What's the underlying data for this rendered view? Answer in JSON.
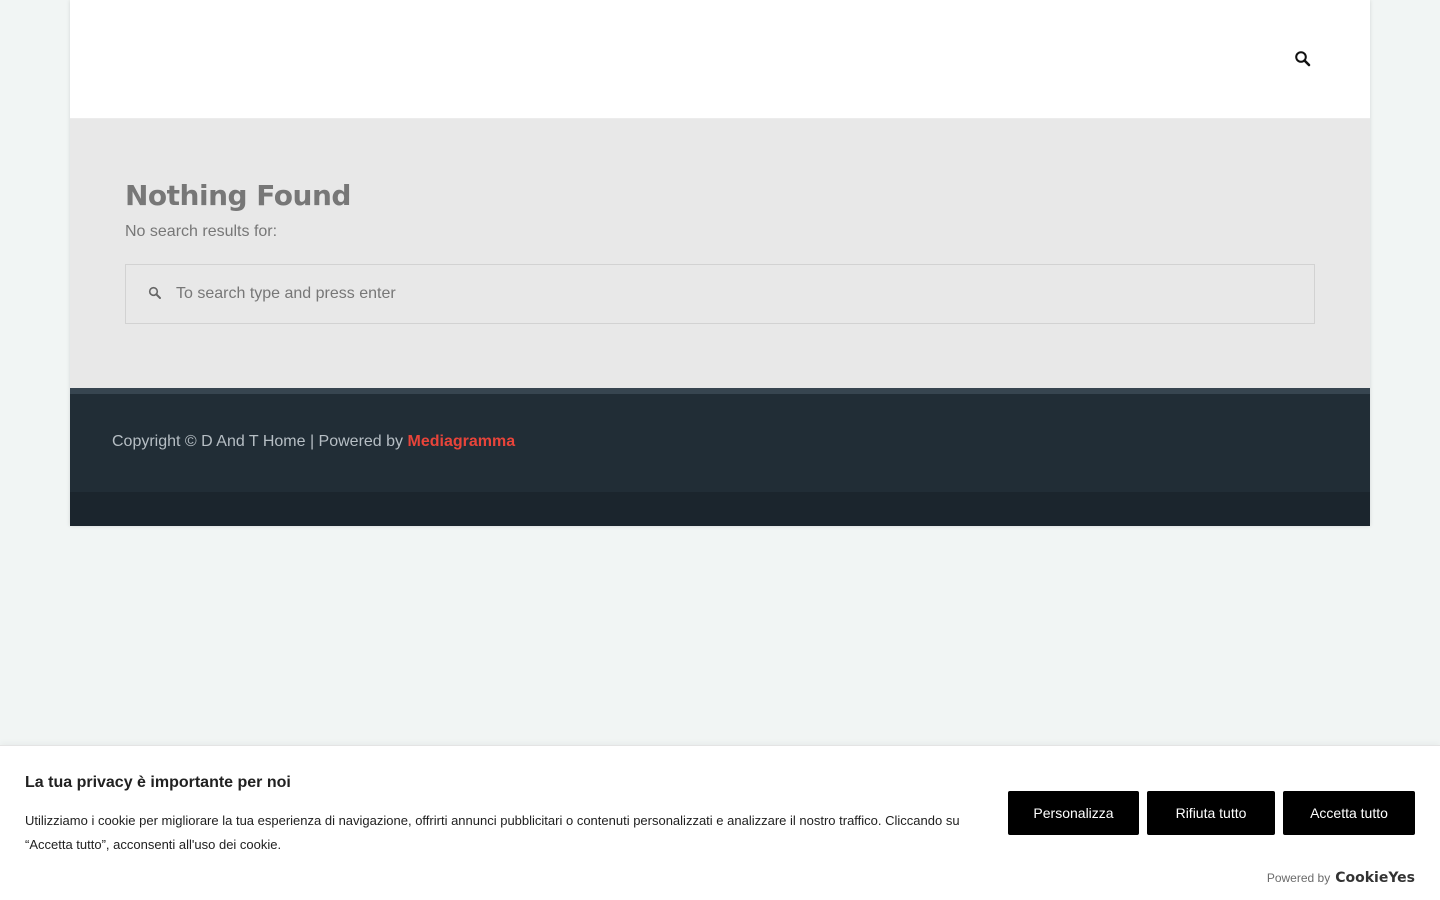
{
  "header": {
    "search_icon": "search-icon"
  },
  "main": {
    "title": "Nothing Found",
    "subtitle": "No search results for:",
    "search": {
      "placeholder": "To search type and press enter",
      "value": "",
      "icon": "search-icon"
    }
  },
  "footer": {
    "copyright": "Copyright © D And T Home | Powered by ",
    "link_label": "Mediagramma",
    "link_color": "#e8443a"
  },
  "cookie_banner": {
    "title": "La tua privacy è importante per noi",
    "description": "Utilizziamo i cookie per migliorare la tua esperienza di navigazione, offrirti annunci pubblicitari o contenuti personalizzati e analizzare il nostro traffico. Cliccando su “Accetta tutto”, acconsenti all'uso dei cookie.",
    "buttons": {
      "customize": "Personalizza",
      "reject": "Rifiuta tutto",
      "accept": "Accetta tutto"
    },
    "powered_by": "Powered by",
    "brand": "CookieYes"
  },
  "colors": {
    "page_background": "#f1f5f4",
    "content_background": "#e8e8e8",
    "footer_background": "#212d36",
    "button_background": "#000000"
  }
}
